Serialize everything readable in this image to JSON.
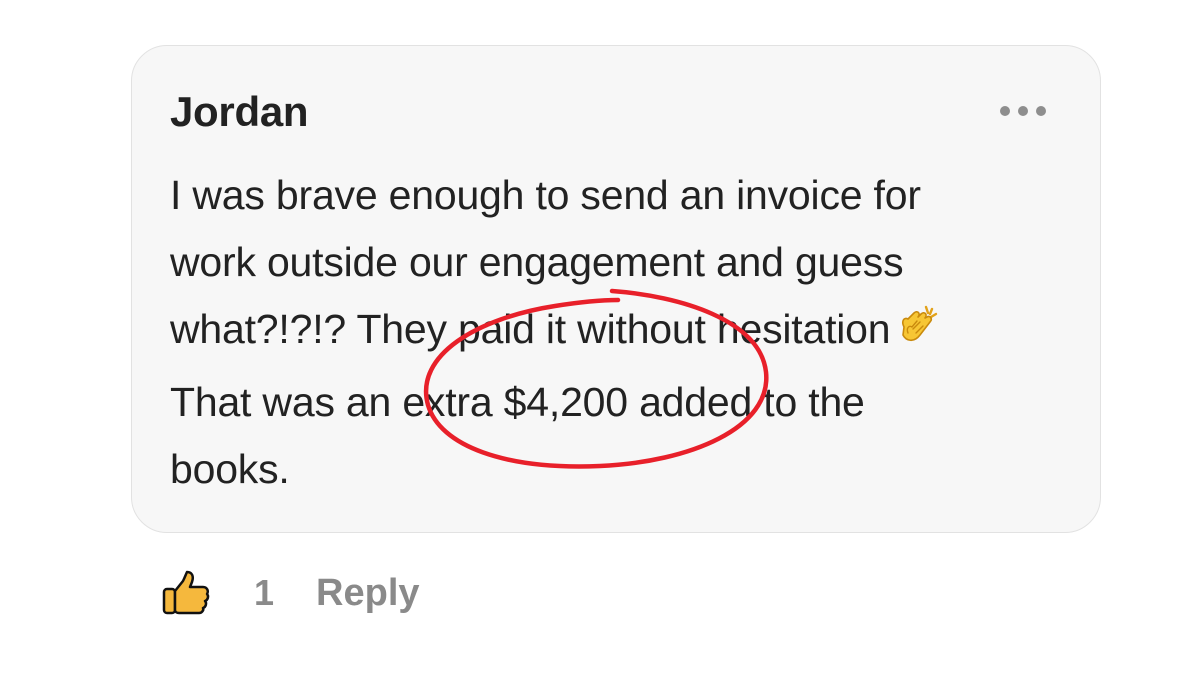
{
  "comment": {
    "author": "Jordan",
    "text_lines": [
      "I was brave enough to send an invoice for",
      "work outside our engagement and guess",
      "what?!?!? They paid it without hesitation",
      "That was an extra $4,200 added to the",
      "books."
    ],
    "emoji": "clapping-hands",
    "highlight_color": "#e8202a"
  },
  "actions": {
    "like_count": "1",
    "reply_label": "Reply"
  },
  "icons": {
    "more": "more-horizontal-icon",
    "like": "thumbs-up-icon",
    "clap": "clapping-hands-icon"
  }
}
